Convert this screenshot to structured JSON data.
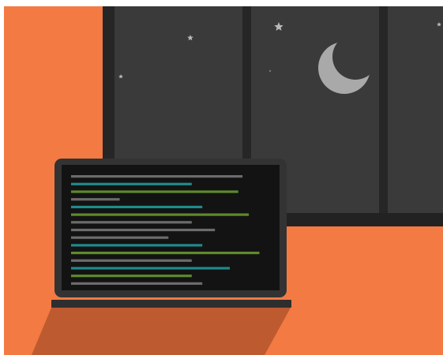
{
  "illustration": {
    "colors": {
      "background": "#FFFFFF",
      "wall": "#F37A43",
      "window_frame": "#262626",
      "window_glass": "#3A3A3A",
      "window_sill": "#222222",
      "moon": "#A9A9A9",
      "stars": "#B8B8B8",
      "laptop_bezel": "#333333",
      "laptop_screen": "#131313",
      "laptop_base": "#2E2E2E",
      "shadow": "#BE5A2F"
    },
    "icons": {
      "moon": "crescent-moon-icon",
      "star": "star-icon"
    },
    "code_lines": [
      {
        "color": "#6B6B6B",
        "length": 0.81
      },
      {
        "color": "#1F8A8C",
        "length": 0.57
      },
      {
        "color": "#5E8A2C",
        "length": 0.79
      },
      {
        "color": "#6B6B6B",
        "length": 0.23
      },
      {
        "color": "#1F8A8C",
        "length": 0.62
      },
      {
        "color": "#5E8A2C",
        "length": 0.84
      },
      {
        "color": "#6B6B6B",
        "length": 0.57
      },
      {
        "color": "#6B6B6B",
        "length": 0.68
      },
      {
        "color": "#6B6B6B",
        "length": 0.46
      },
      {
        "color": "#1F8A8C",
        "length": 0.62
      },
      {
        "color": "#5E8A2C",
        "length": 0.89
      },
      {
        "color": "#6B6B6B",
        "length": 0.57
      },
      {
        "color": "#1F8A8C",
        "length": 0.75
      },
      {
        "color": "#5E8A2C",
        "length": 0.57
      },
      {
        "color": "#6B6B6B",
        "length": 0.62
      }
    ]
  }
}
